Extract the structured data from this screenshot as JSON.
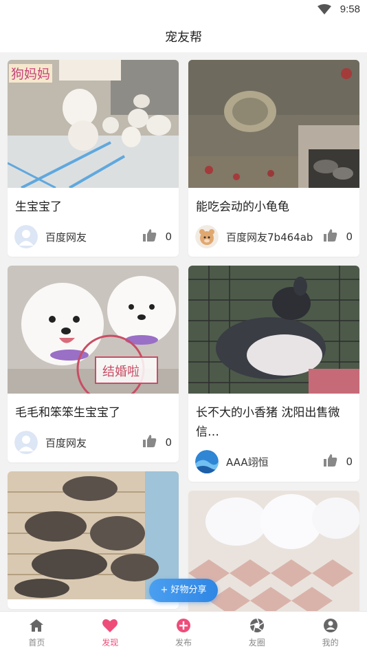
{
  "status": {
    "time": "9:58"
  },
  "header": {
    "title": "宠友帮"
  },
  "feed": {
    "left": [
      {
        "caption": "狗妈妈",
        "title": "生宝宝了",
        "author": "百度网友",
        "likes": "0"
      },
      {
        "stamp": "结婚啦",
        "title": "毛毛和笨笨生宝宝了",
        "author": "百度网友",
        "likes": "0"
      },
      {
        "title": ""
      }
    ],
    "right": [
      {
        "title": "能吃会动的小龟龟",
        "author": "百度网友7b464ab",
        "likes": "0"
      },
      {
        "title": "长不大的小香猪 沈阳出售微信…",
        "author": "AAA翊恒",
        "likes": "0"
      },
      {
        "title": ""
      }
    ]
  },
  "fab": {
    "label": "+ 好物分享"
  },
  "tabs": [
    {
      "label": "首页",
      "icon": "home-icon"
    },
    {
      "label": "发现",
      "icon": "heart-icon",
      "active": true
    },
    {
      "label": "发布",
      "icon": "plus-circle-icon"
    },
    {
      "label": "友圈",
      "icon": "aperture-icon"
    },
    {
      "label": "我的",
      "icon": "user-icon"
    }
  ],
  "colors": {
    "accent": "#ee4d7a",
    "fab": "#2f86e4",
    "tab_inactive": "#888888"
  }
}
